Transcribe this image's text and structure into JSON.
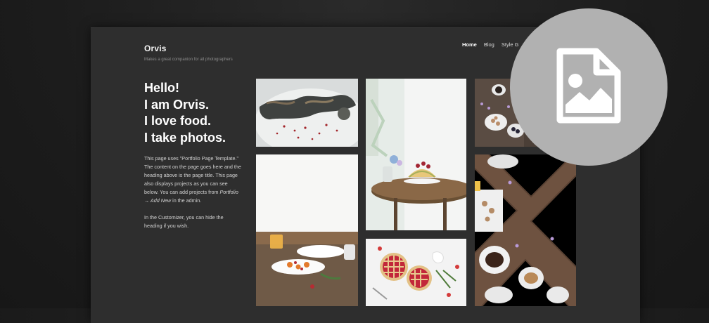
{
  "site": {
    "title": "Orvis",
    "tagline": "Makes a great companion for all photographers"
  },
  "nav": {
    "items": [
      "Home",
      "Blog",
      "Style G"
    ],
    "active": "Home"
  },
  "hero": {
    "lines": [
      "Hello!",
      "I am Orvis.",
      "I love food.",
      "I take photos."
    ]
  },
  "intro": {
    "p1_a": "This page uses \"Portfolio Page Template.\" The content on the page goes here and the heading above is the page title. This page also displays projects as you can see below. You can add projects from ",
    "p1_em1": "Portfolio → Add New",
    "p1_b": " in the admin.",
    "p2": "In the Customizer, you can hide the heading if you wish."
  },
  "overlay": {
    "icon": "image-file-icon"
  },
  "colors": {
    "page_bg": "#1c1c1c",
    "frame_bg": "#2e2e2e",
    "badge": "#b1b1b1",
    "badge_icon": "#ffffff"
  }
}
